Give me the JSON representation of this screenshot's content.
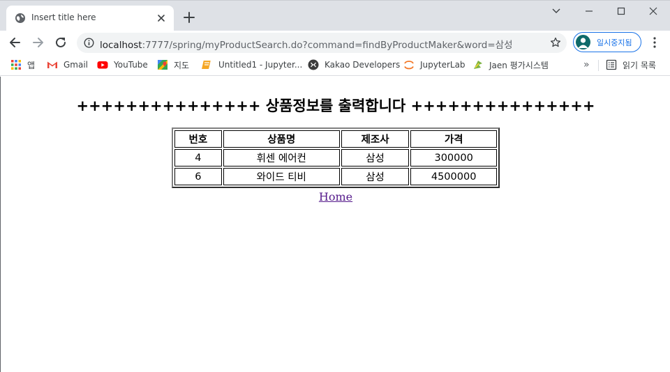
{
  "browser": {
    "tab": {
      "title": "Insert title here",
      "favicon": "globe-icon"
    },
    "url": {
      "host": "localhost",
      "rest": ":7777/spring/myProductSearch.do?command=findByProductMaker&word=삼성"
    },
    "profile": {
      "label": "일시중지됨"
    },
    "bookmarks": [
      {
        "label": "앱",
        "icon": "apps-grid-icon"
      },
      {
        "label": "Gmail",
        "icon": "gmail-icon"
      },
      {
        "label": "YouTube",
        "icon": "youtube-icon"
      },
      {
        "label": "지도",
        "icon": "maps-icon"
      },
      {
        "label": "Untitled1 - Jupyter...",
        "icon": "jupyter-notebook-icon"
      },
      {
        "label": "Kakao Developers",
        "icon": "kakao-icon"
      },
      {
        "label": "JupyterLab",
        "icon": "jupyterlab-icon"
      },
      {
        "label": "Jaen 평가시스템",
        "icon": "jaen-icon"
      }
    ],
    "more_bookmarks": "»",
    "reading_list": {
      "label": "읽기 목록",
      "icon": "reading-list-icon"
    }
  },
  "page": {
    "heading": "+++++++++++++++ 상품정보를 출력합니다 +++++++++++++++",
    "table": {
      "headers": [
        "번호",
        "상품명",
        "제조사",
        "가격"
      ],
      "rows": [
        [
          "4",
          "휘센 에어컨",
          "삼성",
          "300000"
        ],
        [
          "6",
          "와이드 티비",
          "삼성",
          "4500000"
        ]
      ]
    },
    "home_link": "Home"
  }
}
